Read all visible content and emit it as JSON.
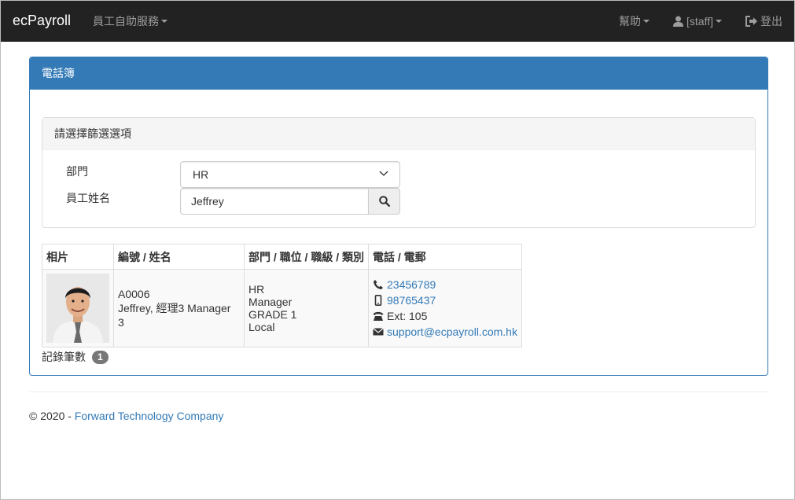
{
  "navbar": {
    "brand": "ecPayroll",
    "self_service": "員工自助服務",
    "help": "幫助",
    "user": "[staff]",
    "logout": "登出"
  },
  "panel": {
    "title": "電話簿"
  },
  "filter": {
    "heading": "請選擇篩選選項",
    "dept_label": "部門",
    "dept_value": "HR",
    "name_label": "員工姓名",
    "name_value": "Jeffrey"
  },
  "table": {
    "headers": [
      "相片",
      "編號 / 姓名",
      "部門 / 職位 / 職級 / 類別",
      "電話 / 電郵"
    ],
    "rows": [
      {
        "id": "A0006",
        "name": "Jeffrey, 經理3 Manager 3",
        "dept": "HR",
        "position": "Manager",
        "grade": "GRADE 1",
        "category": "Local",
        "phone": "23456789",
        "mobile": "98765437",
        "ext": "Ext: 105",
        "email": "support@ecpayroll.com.hk"
      }
    ]
  },
  "record_count": {
    "label": "記錄筆數",
    "value": "1"
  },
  "footer": {
    "copyright": "© 2020 - ",
    "company": "Forward Technology Company"
  },
  "colors": {
    "navbar_bg": "#222222",
    "primary": "#337ab7",
    "badge": "#777777"
  }
}
